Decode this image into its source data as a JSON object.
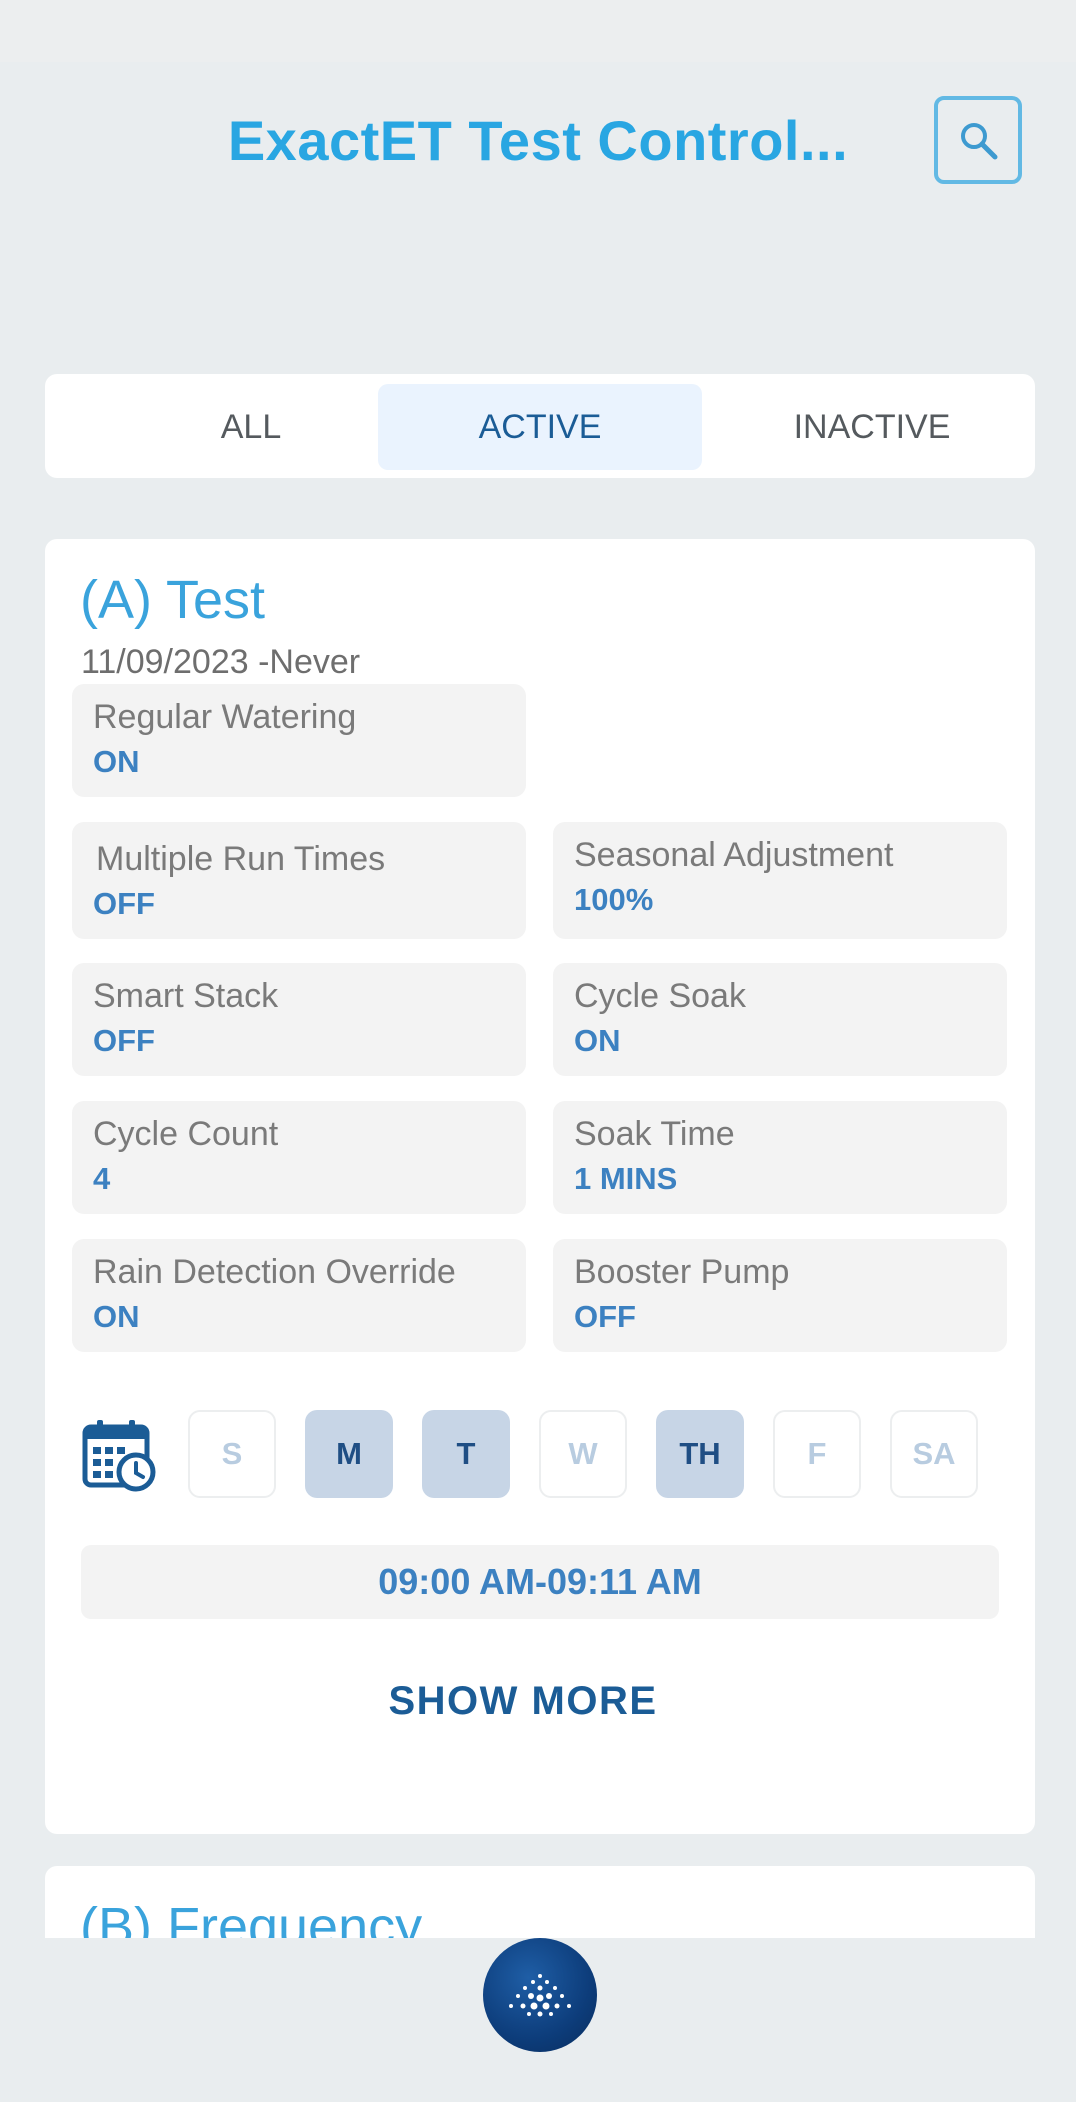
{
  "header": {
    "title": "ExactET Test Control...",
    "search_icon": "search-icon"
  },
  "filters": {
    "tabs": [
      {
        "label": "ALL"
      },
      {
        "label": "ACTIVE"
      },
      {
        "label": "INACTIVE"
      }
    ],
    "selected": "ACTIVE"
  },
  "program_a": {
    "title": "(A) Test",
    "date_range": "11/09/2023 -Never",
    "settings": [
      {
        "label": "Regular Watering",
        "value": "ON"
      },
      {
        "label": "Multiple Run Times",
        "value": "OFF"
      },
      {
        "label": "Seasonal Adjustment",
        "value": "100%"
      },
      {
        "label": "Smart Stack",
        "value": "OFF"
      },
      {
        "label": "Cycle Soak",
        "value": "ON"
      },
      {
        "label": "Cycle Count",
        "value": "4"
      },
      {
        "label": "Soak Time",
        "value": "1 MINS"
      },
      {
        "label": "Rain Detection Override",
        "value": "ON"
      },
      {
        "label": "Booster Pump",
        "value": "OFF"
      }
    ],
    "days": [
      {
        "label": "S",
        "active": false
      },
      {
        "label": "M",
        "active": true
      },
      {
        "label": "T",
        "active": true
      },
      {
        "label": "W",
        "active": false
      },
      {
        "label": "TH",
        "active": true
      },
      {
        "label": "F",
        "active": false
      },
      {
        "label": "SA",
        "active": false
      }
    ],
    "run_time": "09:00 AM-09:11 AM",
    "show_more": "SHOW MORE",
    "schedule_icon": "calendar-clock-icon"
  },
  "program_b": {
    "title": "(B) Frequency"
  },
  "colors": {
    "accent": "#29a6e2",
    "dark_blue": "#1b5c96",
    "value_blue": "#3c81c1",
    "background": "#e9edef"
  }
}
